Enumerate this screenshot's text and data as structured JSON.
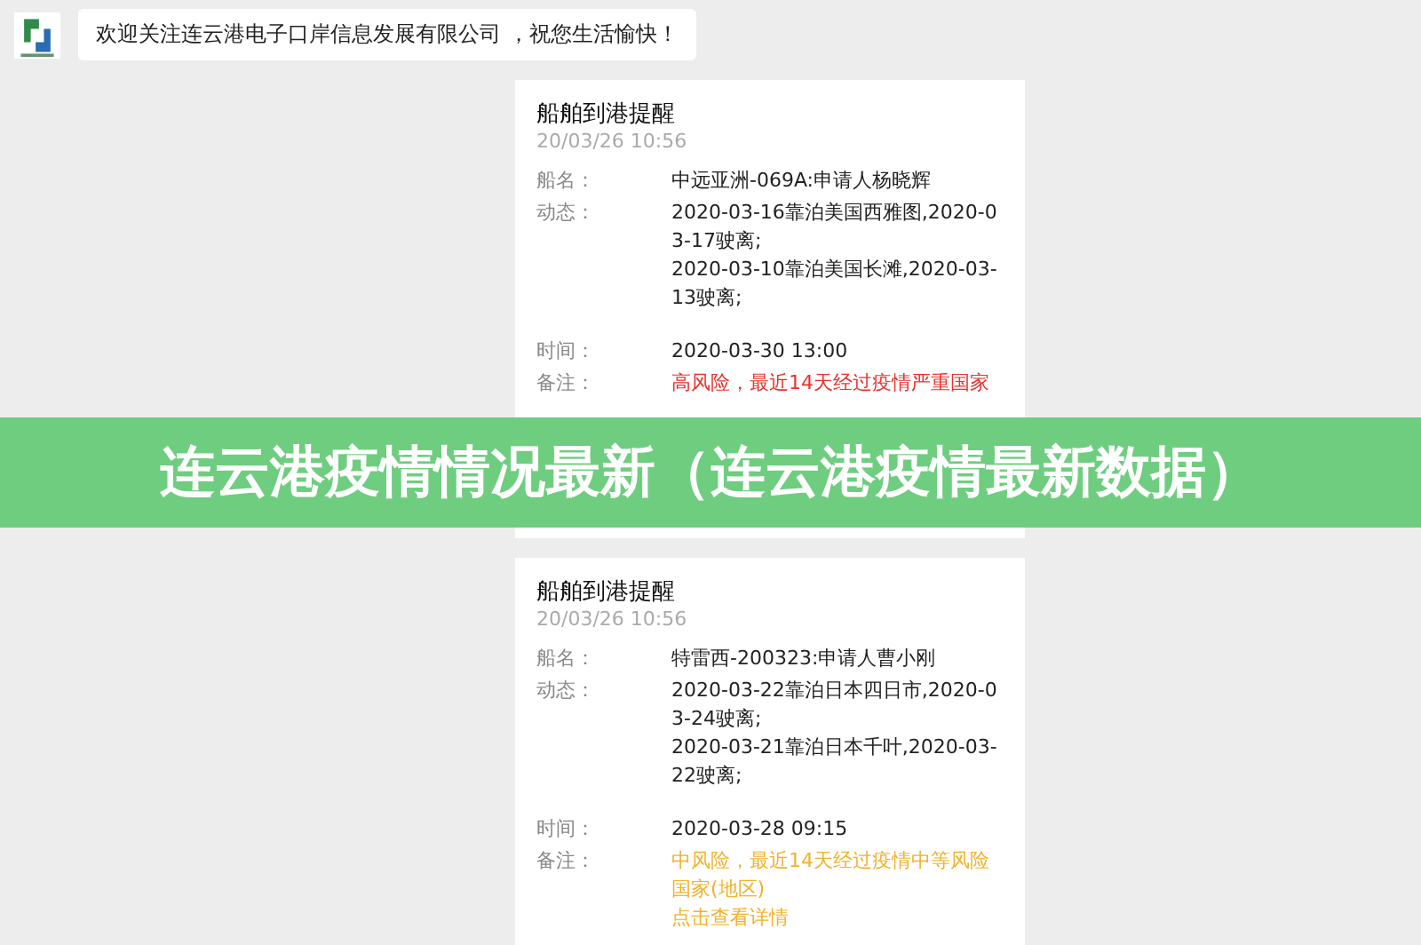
{
  "welcome": {
    "message": "欢迎关注连云港电子口岸信息发展有限公司 ，祝您生活愉快！"
  },
  "cards": [
    {
      "title": "船舶到港提醒",
      "date": "20/03/26 10:56",
      "rows": [
        {
          "label": "船名：",
          "value": "中远亚洲-069A:申请人杨晓辉"
        },
        {
          "label": "动态：",
          "value": "2020-03-16靠泊美国西雅图,2020-03-17驶离;\n2020-03-10靠泊美国长滩,2020-03-13驶离;"
        },
        {
          "label": "时间：",
          "value": "2020-03-30 13:00"
        },
        {
          "label": "备注：",
          "color": "#e8322d",
          "value": "高风险，最近14天经过疫情严重国家"
        }
      ]
    },
    {
      "title": "船舶到港提醒",
      "date": "20/03/26 10:56",
      "rows": [
        {
          "label": "船名：",
          "value": "特雷西-200323:申请人曹小刚"
        },
        {
          "label": "动态：",
          "value": "2020-03-22靠泊日本四日市,2020-03-24驶离;\n2020-03-21靠泊日本千叶,2020-03-22驶离;"
        },
        {
          "label": "时间：",
          "value": "2020-03-28 09:15"
        },
        {
          "label": "备注：",
          "color": "#f1b12c",
          "value": "中风险，最近14天经过疫情中等风险国家(地区)",
          "link": "点击查看详情"
        }
      ]
    }
  ],
  "banner": {
    "title": "连云港疫情情况最新（连云港疫情最新数据）"
  }
}
